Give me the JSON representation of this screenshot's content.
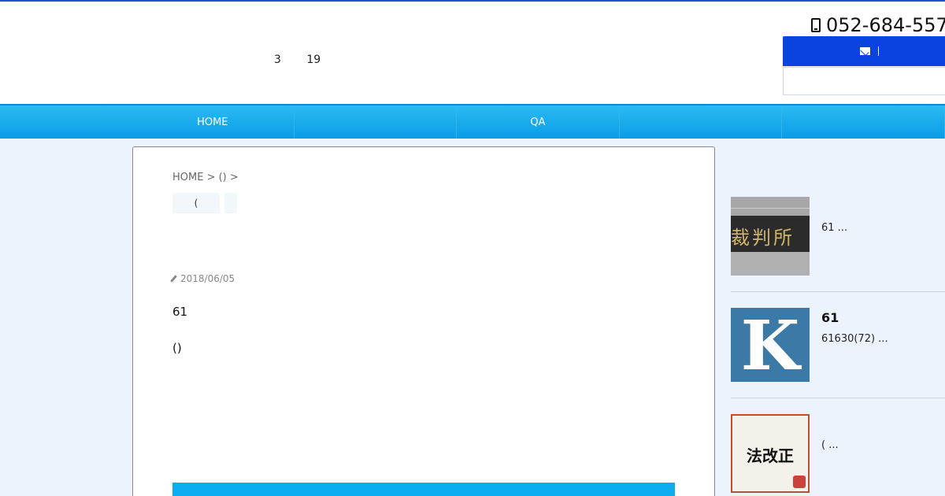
{
  "header": {
    "tagline": "3 19",
    "phone": "052-684-557",
    "mail_label": ""
  },
  "nav": {
    "items": [
      "HOME",
      "",
      "QA",
      "",
      ""
    ]
  },
  "article": {
    "breadcrumb": "HOME > ()    >",
    "tags": [
      "(",
      ""
    ],
    "date": "2018/06/05",
    "paragraphs": [
      "61",
      "()"
    ]
  },
  "sidebar": {
    "posts": [
      {
        "title": "",
        "excerpt": "61 ...",
        "thumb_text": "裁判所"
      },
      {
        "title": "61",
        "excerpt": "61630(72) ...",
        "thumb_text": "K"
      },
      {
        "title": "",
        "excerpt": "( ...",
        "thumb_text": "法改正"
      }
    ]
  },
  "colors": {
    "accent_blue": "#0a43df",
    "nav_blue": "#0daef0",
    "background": "#edf3fc"
  }
}
